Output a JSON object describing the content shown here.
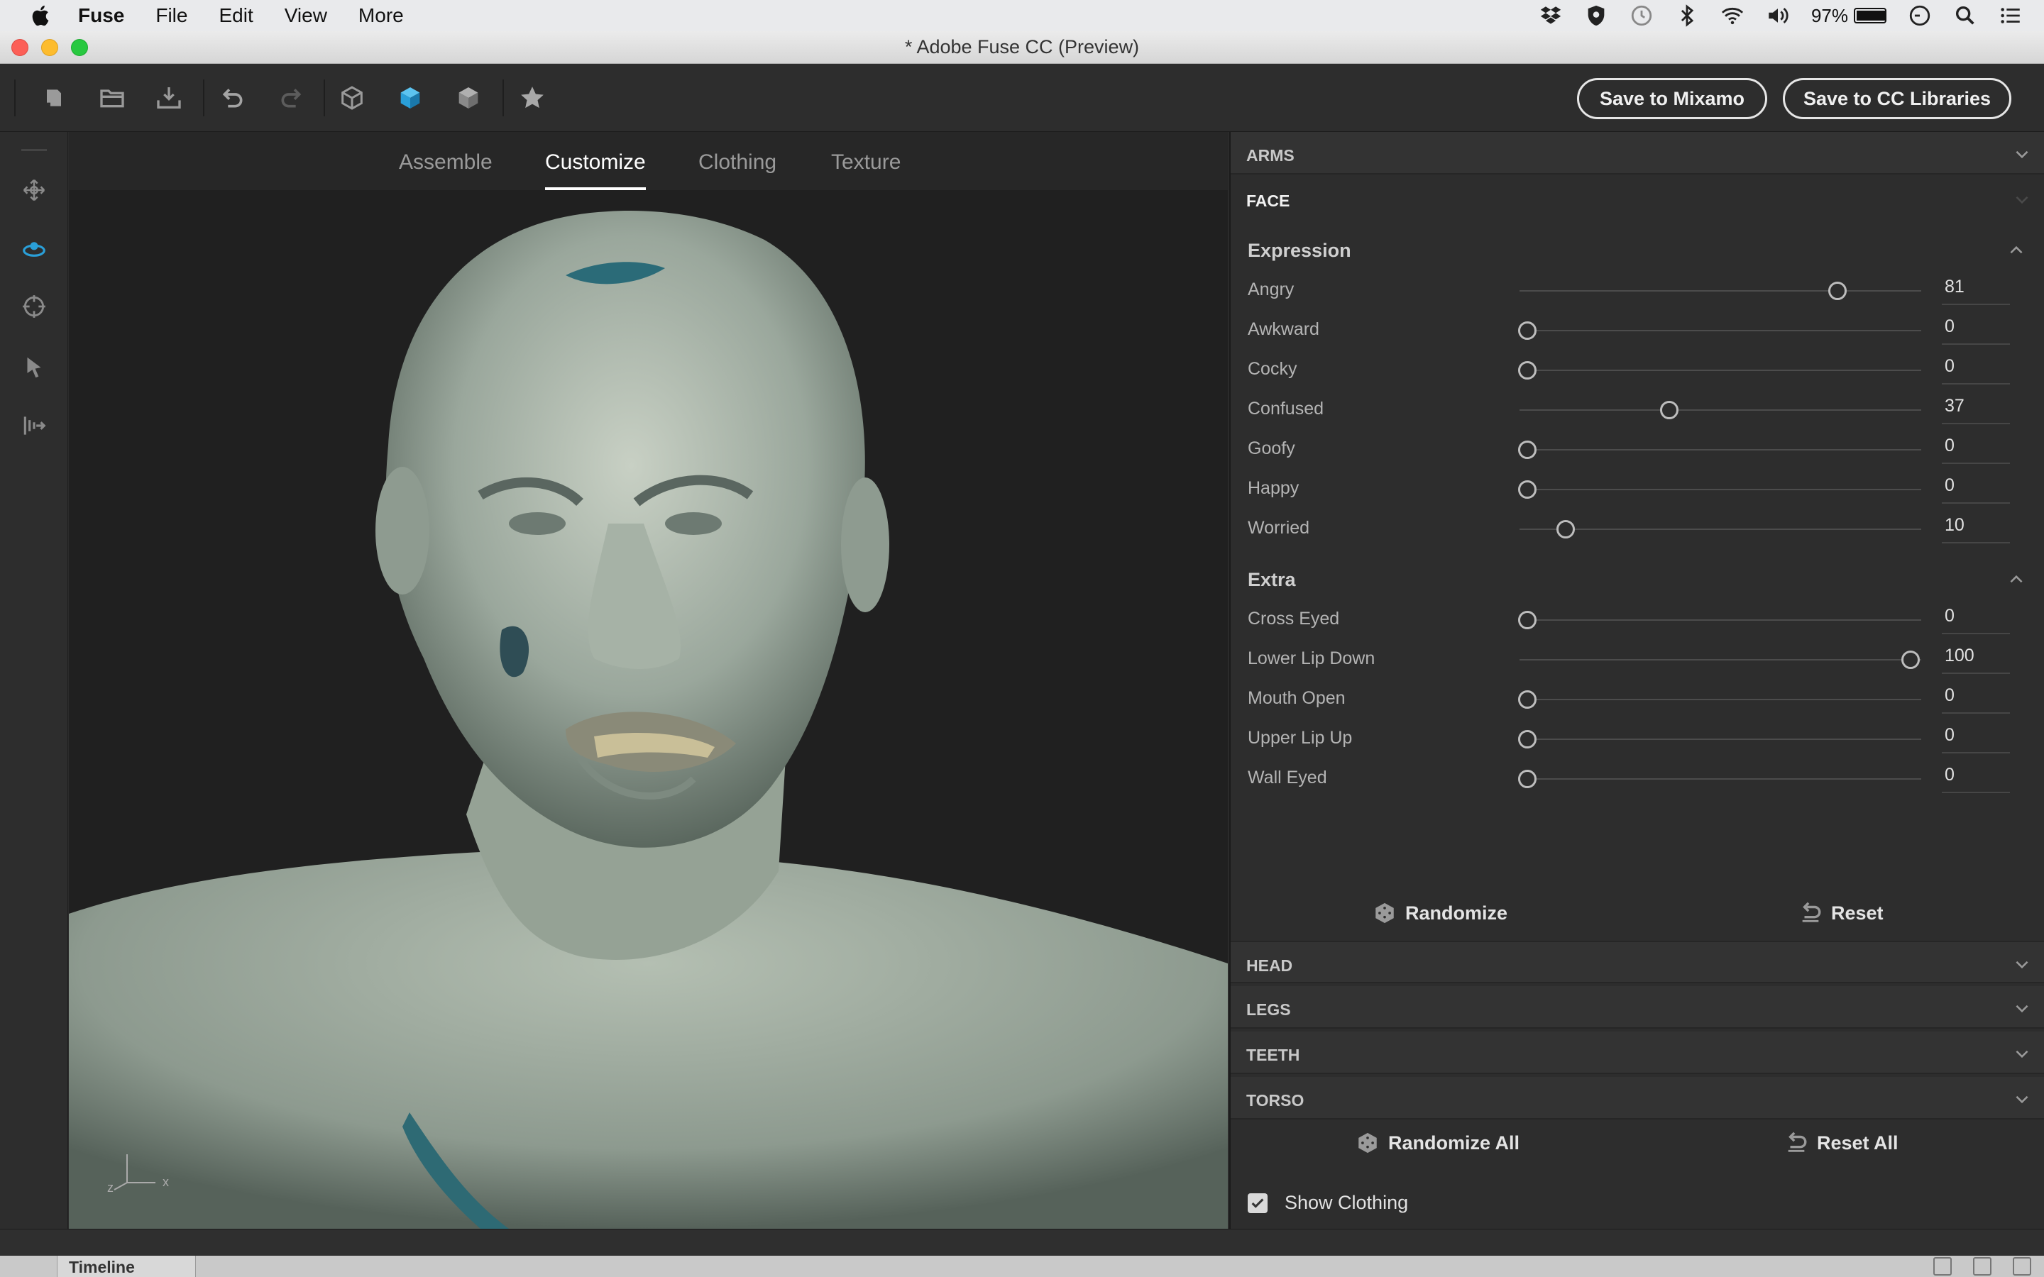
{
  "menubar": {
    "app_name": "Fuse",
    "items": [
      "File",
      "Edit",
      "View",
      "More"
    ],
    "battery_text": "97%"
  },
  "window": {
    "title": "* Adobe Fuse CC (Preview)"
  },
  "toolbar": {
    "save_mixamo": "Save to Mixamo",
    "save_cc": "Save to CC Libraries"
  },
  "tabs": [
    "Assemble",
    "Customize",
    "Clothing",
    "Texture"
  ],
  "active_tab": "Customize",
  "axis": {
    "z": "z",
    "x": "x"
  },
  "panel": {
    "sections_top": [
      {
        "label": "ARMS",
        "expanded": false
      },
      {
        "label": "FACE",
        "expanded": true
      }
    ],
    "expression": {
      "title": "Expression",
      "sliders": [
        {
          "name": "Angry",
          "value": "81"
        },
        {
          "name": "Awkward",
          "value": "0"
        },
        {
          "name": "Cocky",
          "value": "0"
        },
        {
          "name": "Confused",
          "value": "37"
        },
        {
          "name": "Goofy",
          "value": "0"
        },
        {
          "name": "Happy",
          "value": "0"
        },
        {
          "name": "Worried",
          "value": "10"
        }
      ]
    },
    "extra": {
      "title": "Extra",
      "sliders": [
        {
          "name": "Cross Eyed",
          "value": "0"
        },
        {
          "name": "Lower Lip Down",
          "value": "100"
        },
        {
          "name": "Mouth Open",
          "value": "0"
        },
        {
          "name": "Upper Lip Up",
          "value": "0"
        },
        {
          "name": "Wall Eyed",
          "value": "0"
        }
      ]
    },
    "randomize": "Randomize",
    "reset": "Reset",
    "sections_bottom": [
      {
        "label": "HEAD"
      },
      {
        "label": "LEGS"
      },
      {
        "label": "TEETH"
      },
      {
        "label": "TORSO"
      }
    ],
    "randomize_all": "Randomize All",
    "reset_all": "Reset All",
    "show_clothing": {
      "label": "Show Clothing",
      "checked": true
    }
  },
  "timeline": {
    "label": "Timeline"
  },
  "colors": {
    "accent": "#2a9fd8",
    "panel_bg": "#2d2d2d",
    "viewport_bg": "#202020"
  }
}
